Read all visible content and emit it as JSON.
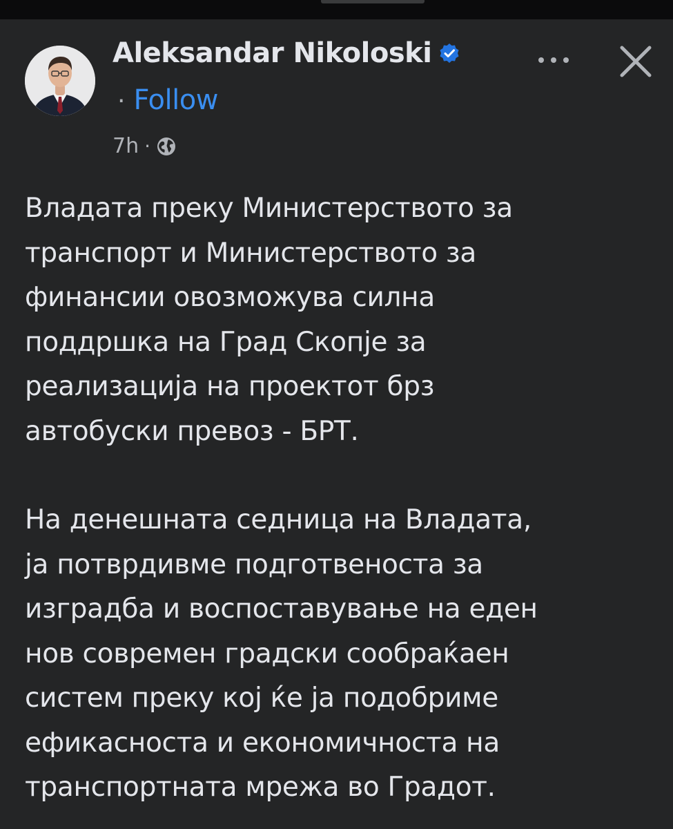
{
  "post": {
    "author": {
      "name": "Aleksandar Nikoloski",
      "verified": true,
      "avatar_icon": "profile-photo"
    },
    "follow": {
      "separator": "·",
      "label": "Follow"
    },
    "meta": {
      "time": "7h",
      "separator": "·",
      "audience_icon": "globe-icon"
    },
    "paragraphs": [
      "Владата преку Министерството за\nтранспорт и Министерството за\nфинансии овозможува силна\nподдршка на Град Скопје за\nреализација на проектот брз\nавтобуски превоз - БРТ.",
      "На денешната седница на Владата,\nја потврдивме подготвеноста за\nизградба и воспоставување на еден\nнов современ градски сообраќаен\nсистем преку кој ќе ја подобриме\nефикасноста и економичноста на\nтранспортната мрежа во Градот."
    ],
    "actions": {
      "more_label": "•••",
      "close_icon": "close-icon"
    }
  },
  "colors": {
    "background": "#242526",
    "text": "#e4e6eb",
    "secondary_text": "#b0b3b8",
    "link": "#3a8ef0",
    "verified_badge": "#2374e1"
  }
}
